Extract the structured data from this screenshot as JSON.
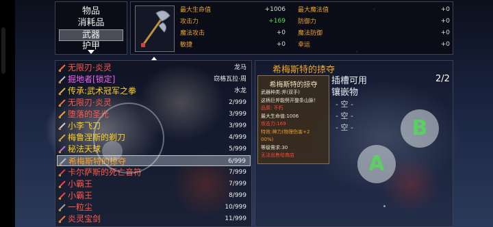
{
  "categories": {
    "items": [
      "物品",
      "消耗品",
      "武器",
      "护甲"
    ],
    "selected_index": 2
  },
  "stats": {
    "left": [
      {
        "label": "最大生命值",
        "value": "+1006",
        "green": false
      },
      {
        "label": "攻击力",
        "value": "+169",
        "green": true
      },
      {
        "label": "魔法攻击",
        "value": "+0",
        "green": false
      },
      {
        "label": "敏捷",
        "value": "+0",
        "green": false
      }
    ],
    "right": [
      {
        "label": "最大魔法值",
        "value": "+0"
      },
      {
        "label": "防御力",
        "value": "+0"
      },
      {
        "label": "魔法防御",
        "value": "+0"
      },
      {
        "label": "幸运",
        "value": "+0"
      }
    ]
  },
  "items": [
    {
      "name": "无限刃·炎灵",
      "count": "龙马",
      "color": "#ff5a4a",
      "icon": "sword-icon",
      "icon_color": "#ff6a3a"
    },
    {
      "name": "掘地者[锁定]",
      "count": "窃格瓦拉·周",
      "color": "#f060f0",
      "icon": "pickaxe-icon",
      "icon_color": "#c0c0c0"
    },
    {
      "name": "传承:武术冠军之拳",
      "count": "水龙",
      "color": "#ffd020",
      "icon": "fist-icon",
      "icon_color": "#e0b040"
    },
    {
      "name": "无限刃·炎灵",
      "count": "2/999",
      "color": "#ff5a4a",
      "icon": "sword-icon",
      "icon_color": "#ff6a3a"
    },
    {
      "name": "堕落的圣光",
      "count": "3/999",
      "color": "#ff5a4a",
      "icon": "sword-icon",
      "icon_color": "#ff9a3a"
    },
    {
      "name": "小李飞刀",
      "count": "3/999",
      "color": "#ffd020",
      "icon": "knife-icon",
      "icon_color": "#d0d0d0"
    },
    {
      "name": "梅鲁涅斯的剃刀",
      "count": "4/999",
      "color": "#ffd020",
      "icon": "razor-icon",
      "icon_color": "#e0a040"
    },
    {
      "name": "秘法天球",
      "count": "5/999",
      "color": "#ffd020",
      "icon": "staff-icon",
      "icon_color": "#c070e0"
    },
    {
      "name": "希梅斯特的掠夺",
      "count": "6/999",
      "color": "#ffa020",
      "icon": "axe-icon",
      "icon_color": "#b0c0d0"
    },
    {
      "name": "卡尔萨斯的死亡音符",
      "count": "7/999",
      "color": "#ff5a4a",
      "icon": "scythe-icon",
      "icon_color": "#e04040"
    },
    {
      "name": "小霸王",
      "count": "7/999",
      "color": "#ff5a4a",
      "icon": "orb-icon",
      "icon_color": "#ff4040"
    },
    {
      "name": "小霸王",
      "count": "8/999",
      "color": "#ff5a4a",
      "icon": "orb-icon",
      "icon_color": "#ff4040"
    },
    {
      "name": "一粒尘",
      "count": "10/999",
      "color": "#ff5a4a",
      "icon": "dust-icon",
      "icon_color": "#a0a0a0"
    },
    {
      "name": "炎灵宝剑",
      "count": "11/999",
      "color": "#ff5a4a",
      "icon": "sword-icon",
      "icon_color": "#ff6a3a"
    }
  ],
  "selected_item_index": 8,
  "detail": {
    "title": "希梅斯特的掠夺",
    "subtitle1": "插槽可用",
    "subtitle2": "镶嵌物",
    "page": "2/2",
    "slots": [
      "- 空 -",
      "- 空 -",
      "- 空 -"
    ]
  },
  "tooltip": {
    "title": "希梅斯特的掠夺",
    "lines": [
      {
        "text": "武器种类:斧(双手)",
        "tone": "w"
      },
      {
        "text": "这柄巨斧能劈开整条山脉！",
        "tone": "w"
      },
      {
        "text": "品质: 不朽",
        "tone": "r"
      },
      {
        "text": "最大生命值:1006",
        "tone": "w"
      },
      {
        "text": "攻击力:169",
        "tone": "r"
      },
      {
        "text": "特效:神力(物理伤害+2",
        "tone": "o"
      },
      {
        "text": "00%)",
        "tone": "o"
      },
      {
        "text": "等级需求:30",
        "tone": "w"
      },
      {
        "text": "无法出售给商店",
        "tone": "r"
      }
    ]
  },
  "buttons": {
    "a": "A",
    "b": "B"
  }
}
